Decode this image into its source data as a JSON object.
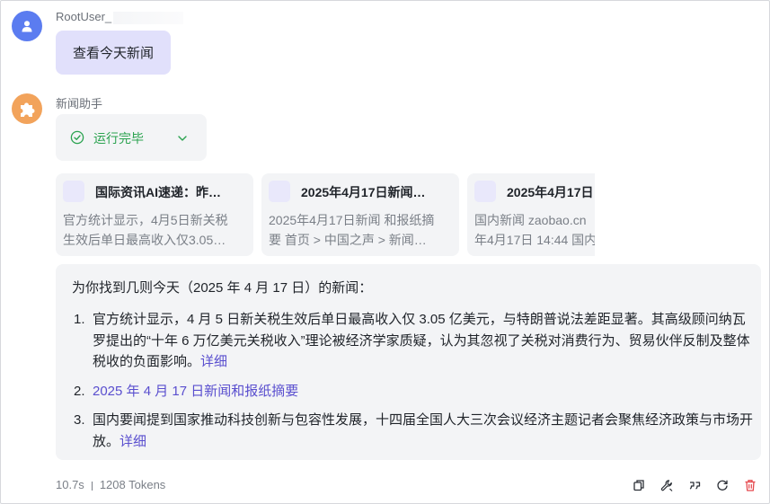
{
  "user_message": {
    "username": "RootUser_",
    "text": "查看今天新闻"
  },
  "assistant": {
    "name": "新闻助手",
    "status": "运行完毕"
  },
  "sources": [
    {
      "title": "国际资讯AI速递：昨…",
      "desc_line1": "官方统计显示，4月5日新关税",
      "desc_line2": "生效后单日最高收入仅3.05…"
    },
    {
      "title": "2025年4月17日新闻…",
      "desc_line1": "2025年4月17日新闻 和报纸摘",
      "desc_line2": "要 首页 > 中国之声 > 新闻…"
    },
    {
      "title": "2025年4月17日",
      "desc_line1": "国内新闻 zaobao.cn",
      "desc_line2": "年4月17日 14:44 国内"
    }
  ],
  "answer": {
    "intro": "为你找到几则今天（2025 年 4 月 17 日）的新闻：",
    "items": [
      {
        "num": "1.",
        "text": "官方统计显示，4 月 5 日新关税生效后单日最高收入仅 3.05 亿美元，与特朗普说法差距显著。其高级顾问纳瓦罗提出的“十年 6 万亿美元关税收入”理论被经济学家质疑，认为其忽视了关税对消费行为、贸易伙伴反制及整体税收的负面影响。",
        "link": "详细"
      },
      {
        "num": "2.",
        "link": "2025 年 4 月 17 日新闻和报纸摘要"
      },
      {
        "num": "3.",
        "text": "国内要闻提到国家推动科技创新与包容性发展，十四届全国人大三次会议经济主题记者会聚焦经济政策与市场开放。",
        "link": "详细"
      }
    ]
  },
  "footer": {
    "time": "10.7s",
    "tokens": "1208 Tokens"
  },
  "colors": {
    "user_bubble": "#e1e0fb",
    "status_green": "#2aa24f",
    "link": "#5a4fcf",
    "delete": "#e5484d"
  }
}
